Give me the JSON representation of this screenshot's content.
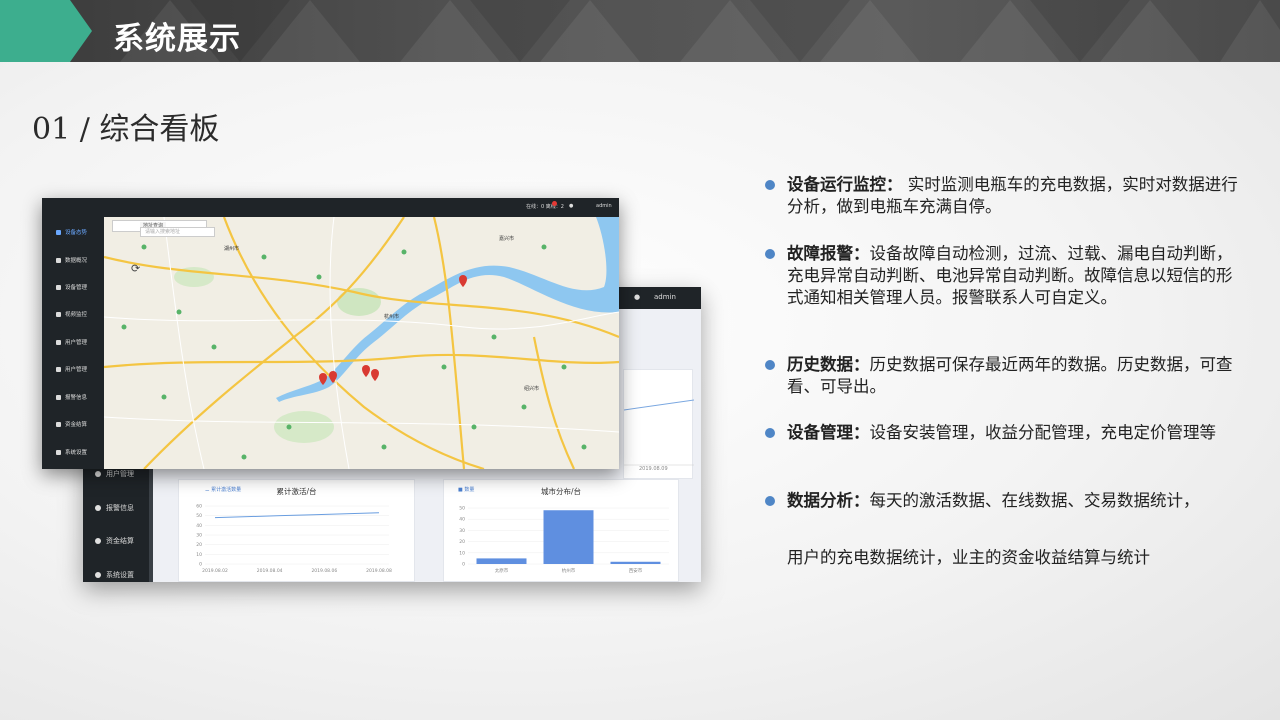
{
  "header": {
    "title": "系统展示"
  },
  "section": {
    "title": "01 / 综合看板"
  },
  "colors": {
    "accent_green": "#3dae8e",
    "bullet_blue": "#4f86c6",
    "dark_bar": "#1f2428",
    "menu_active": "#6aa8ff"
  },
  "front_window": {
    "status_text": "在线：0    离线：2",
    "user": "admin",
    "sidebar": [
      {
        "label": "设备态势",
        "icon": "location-icon",
        "active": true
      },
      {
        "label": "数据概况",
        "icon": "chart-icon"
      },
      {
        "label": "设备管理",
        "icon": "device-icon"
      },
      {
        "label": "视频监控",
        "icon": "camera-icon"
      },
      {
        "label": "用户管理",
        "icon": "user-icon"
      },
      {
        "label": "用户管理",
        "icon": "user-icon"
      },
      {
        "label": "报警信息",
        "icon": "bell-icon"
      },
      {
        "label": "资金结算",
        "icon": "coin-icon"
      },
      {
        "label": "系统设置",
        "icon": "gear-icon"
      }
    ],
    "map": {
      "search_tab": "地址查询",
      "search_placeholder": "请输入搜索地址",
      "city_labels": [
        "杭州市",
        "绍兴市",
        "湖州市",
        "嘉兴市"
      ]
    }
  },
  "back_window": {
    "user": "admin",
    "sidebar": [
      {
        "label": "用户管理",
        "icon": "user-icon"
      },
      {
        "label": "报警信息",
        "icon": "bell-icon"
      },
      {
        "label": "资金结算",
        "icon": "coin-icon"
      },
      {
        "label": "系统设置",
        "icon": "gear-icon"
      }
    ],
    "top_chart_last_date": "2019.08.09",
    "line_panel": {
      "title": "累计激活/台",
      "legend": "累计激活数量",
      "yticks": [
        "60",
        "50",
        "40",
        "30",
        "20",
        "10",
        "0"
      ],
      "xticks": [
        "2019.08.02",
        "2019.08.04",
        "2019.08.06",
        "2019.08.08"
      ],
      "values": [
        48,
        49,
        50,
        51,
        52,
        53
      ]
    },
    "bar_panel": {
      "title": "城市分布/台",
      "legend": "数量",
      "yticks": [
        "50",
        "40",
        "30",
        "20",
        "10",
        "0"
      ],
      "categories": [
        "太原市",
        "杭州市",
        "西安市"
      ],
      "values": [
        5,
        48,
        2
      ]
    }
  },
  "bullets": [
    {
      "label": "设备运行监控：",
      "text": " 实时监测电瓶车的充电数据，实时对数据进行分析，做到电瓶车充满自停。"
    },
    {
      "label": "故障报警：",
      "text": "设备故障自动检测，过流、过载、漏电自动判断，充电异常自动判断、电池异常自动判断。故障信息以短信的形式通知相关管理人员。报警联系人可自定义。"
    },
    {
      "label": "历史数据：",
      "text": "历史数据可保存最近两年的数据。历史数据，可查看、可导出。"
    },
    {
      "label": "设备管理：",
      "text": "设备安装管理，收益分配管理，充电定价管理等"
    },
    {
      "label": "数据分析：",
      "text": "每天的激活数据、在线数据、交易数据统计，"
    }
  ],
  "bullet_continuation": "用户的充电数据统计，业主的资金收益结算与统计"
}
